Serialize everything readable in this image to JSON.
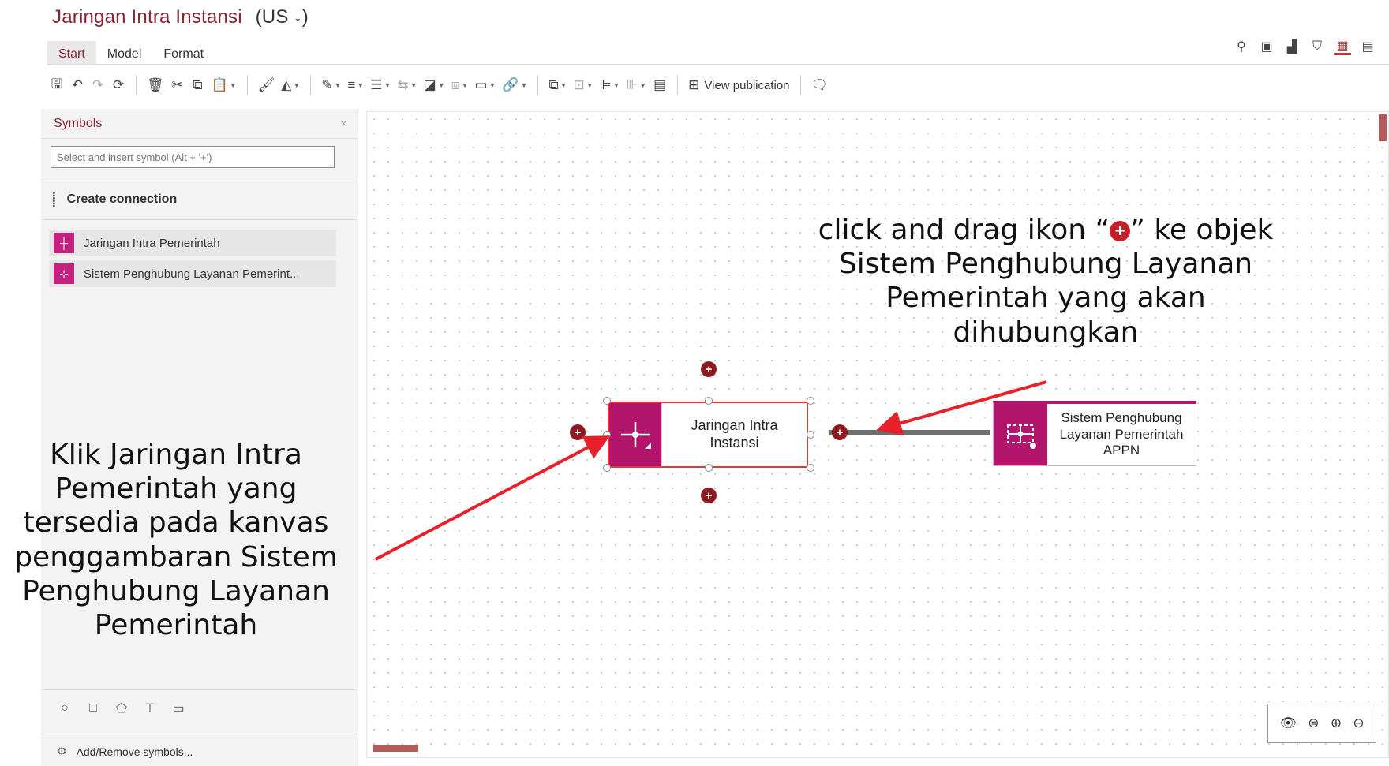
{
  "window": {
    "title": "Jaringan Intra Instansi",
    "language": "(US",
    "language_caret": "⌄",
    "language_close": ")"
  },
  "menu": {
    "tabs": [
      "Start",
      "Model",
      "Format"
    ],
    "active_tab": "Start"
  },
  "right_tools": [
    "search-icon",
    "info-icon",
    "bar-chart-icon",
    "shield-icon",
    "dashboard-icon",
    "comment-icon"
  ],
  "toolbar": {
    "view_publication_label": "View publication"
  },
  "sidebar": {
    "title": "Symbols",
    "close_glyph": "×",
    "search_placeholder": "Select and insert symbol (Alt + '+')",
    "create_connection_label": "Create connection",
    "items": [
      {
        "label": "Jaringan Intra Pemerintah",
        "icon": "network-node-icon",
        "color": "#c3237f"
      },
      {
        "label": "Sistem Penghubung Layanan Pemerint...",
        "icon": "service-bus-icon",
        "color": "#c3237f"
      }
    ],
    "add_remove_label": "Add/Remove symbols..."
  },
  "canvas": {
    "nodes": [
      {
        "label": "Jaringan Intra Instansi",
        "color": "#b3156d",
        "selected": true
      },
      {
        "label": "Sistem Penghubung Layanan Pemerintah APPN",
        "color": "#b3156d",
        "selected": false
      }
    ],
    "plus_glyph": "+"
  },
  "annotations": {
    "top_right_before": "click and drag ikon “",
    "top_right_after": "” ke objek Sistem Penghubung Layanan Pemerintah yang akan dihubungkan",
    "left": "Klik Jaringan Intra Pemerintah yang tersedia pada kanvas penggambaran Sistem Penghubung Layanan Pemerintah",
    "arrow_color": "#e8202a"
  },
  "zoom_controls": [
    "eye-icon",
    "zoom-100-icon",
    "zoom-in-icon",
    "zoom-out-icon"
  ]
}
